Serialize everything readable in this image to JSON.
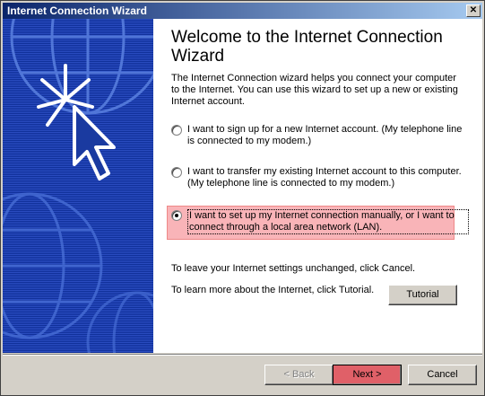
{
  "window": {
    "title": "Internet Connection Wizard"
  },
  "content": {
    "heading": "Welcome to the Internet Connection Wizard",
    "intro": "The Internet Connection wizard helps you connect your computer to the Internet.  You can use this wizard to set up a new or existing Internet account.",
    "options": [
      {
        "label": "I want to sign up for a new Internet account. (My telephone line is connected to my modem.)",
        "selected": false
      },
      {
        "label": "I want to transfer my existing Internet account to this computer. (My telephone line is connected to my modem.)",
        "selected": false
      },
      {
        "label": "I want to set up my Internet connection manually, or I want to connect through a local area network (LAN).",
        "selected": true
      }
    ],
    "cancel_note": "To leave your Internet settings unchanged, click Cancel.",
    "tutorial_note": "To learn more about the Internet, click Tutorial.",
    "tutorial_button": "Tutorial"
  },
  "buttons": {
    "back": "< Back",
    "next": "Next >",
    "cancel": "Cancel"
  },
  "colors": {
    "titlebar": "#0a246a",
    "art_background": "#1a3aa0",
    "highlight": "#f9b4b8"
  }
}
